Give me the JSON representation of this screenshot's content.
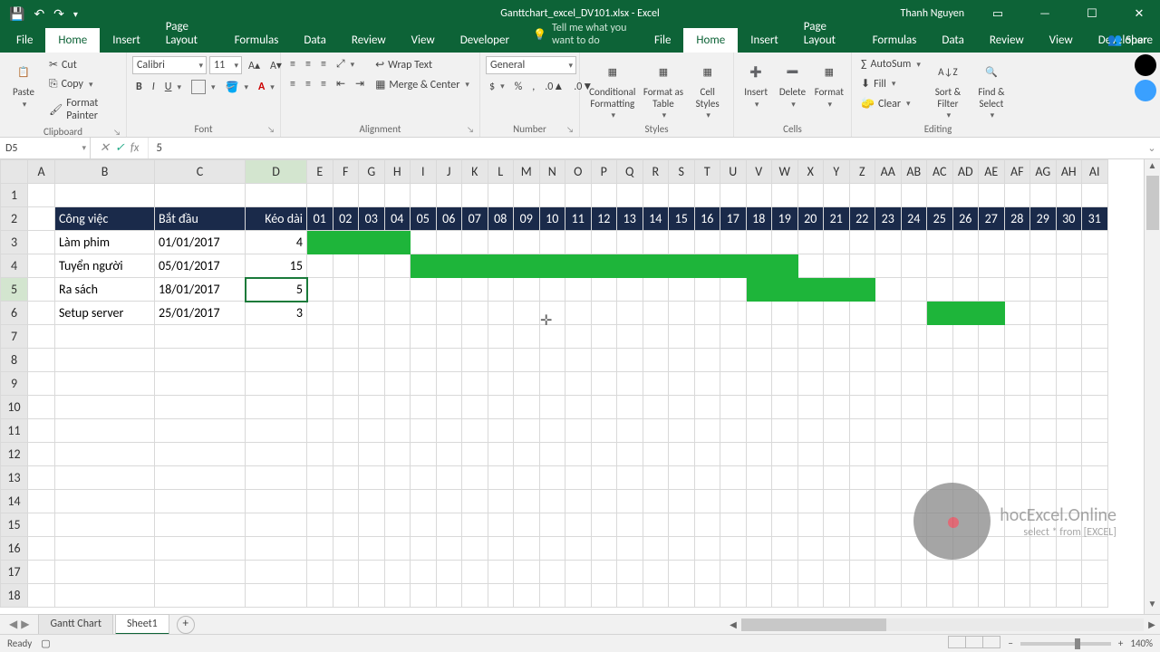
{
  "title": "Ganttchart_excel_DV101.xlsx  -  Excel",
  "user": "Thanh Nguyen",
  "tabs": [
    "File",
    "Home",
    "Insert",
    "Page Layout",
    "Formulas",
    "Data",
    "Review",
    "View",
    "Developer"
  ],
  "active_tab": "Home",
  "tellme": "Tell me what you want to do",
  "share": "Share",
  "clipboard": {
    "label": "Clipboard",
    "paste": "Paste",
    "cut": "Cut",
    "copy": "Copy",
    "painter": "Format Painter"
  },
  "font": {
    "label": "Font",
    "name": "Calibri",
    "size": "11"
  },
  "alignment": {
    "label": "Alignment",
    "wrap": "Wrap Text",
    "merge": "Merge & Center"
  },
  "number": {
    "label": "Number",
    "format": "General"
  },
  "styles": {
    "label": "Styles",
    "cond": "Conditional Formatting",
    "table": "Format as Table",
    "cell": "Cell Styles"
  },
  "cells": {
    "label": "Cells",
    "insert": "Insert",
    "delete": "Delete",
    "format": "Format"
  },
  "editing": {
    "label": "Editing",
    "autosum": "AutoSum",
    "fill": "Fill",
    "clear": "Clear",
    "sort": "Sort & Filter",
    "find": "Find & Select"
  },
  "namebox": "D5",
  "formula": "5",
  "columns": [
    "A",
    "B",
    "C",
    "D",
    "E",
    "F",
    "G",
    "H",
    "I",
    "J",
    "K",
    "L",
    "M",
    "N",
    "O",
    "P",
    "Q",
    "R",
    "S",
    "T",
    "U",
    "V",
    "W",
    "X",
    "Y",
    "Z",
    "AA",
    "AB",
    "AC",
    "AD",
    "AE",
    "AF",
    "AG",
    "AH",
    "AI"
  ],
  "row_count": 18,
  "headers": {
    "task": "Công việc",
    "start": "Bắt đầu",
    "duration": "Kéo dài"
  },
  "day_headers": [
    "01",
    "02",
    "03",
    "04",
    "05",
    "06",
    "07",
    "08",
    "09",
    "10",
    "11",
    "12",
    "13",
    "14",
    "15",
    "16",
    "17",
    "18",
    "19",
    "20",
    "21",
    "22",
    "23",
    "24",
    "25",
    "26",
    "27",
    "28",
    "29",
    "30",
    "31"
  ],
  "tasks": [
    {
      "name": "Làm phim",
      "start": "01/01/2017",
      "dur": "4",
      "startDay": 1,
      "len": 4
    },
    {
      "name": "Tuyển người",
      "start": "05/01/2017",
      "dur": "15",
      "startDay": 5,
      "len": 15
    },
    {
      "name": "Ra sách",
      "start": "18/01/2017",
      "dur": "5",
      "startDay": 18,
      "len": 5
    },
    {
      "name": "Setup server",
      "start": "25/01/2017",
      "dur": "3",
      "startDay": 25,
      "len": 3
    }
  ],
  "selected_cell": {
    "row": 5,
    "col": "D"
  },
  "sheet_tabs": [
    "Gantt Chart",
    "Sheet1"
  ],
  "active_sheet": "Sheet1",
  "status": "Ready",
  "zoom": "140%",
  "watermark": {
    "l1": "hocExcel.Online",
    "l2": "select * from [EXCEL]"
  }
}
